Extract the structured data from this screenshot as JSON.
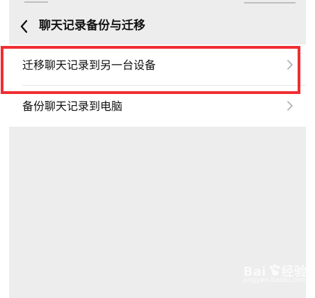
{
  "page": {
    "title": "聊天记录备份与迁移"
  },
  "list": {
    "items": [
      {
        "label": "迁移聊天记录到另一台设备",
        "icon": "chevron-right-icon"
      },
      {
        "label": "备份聊天记录到电脑",
        "icon": "chevron-right-icon"
      }
    ]
  },
  "watermark": {
    "brand": "Bai",
    "brand_suffix": "经验",
    "sub": "jingyan.baidu.com"
  },
  "colors": {
    "highlight": "#f02d32",
    "background": "#ededed",
    "card": "#ffffff"
  }
}
